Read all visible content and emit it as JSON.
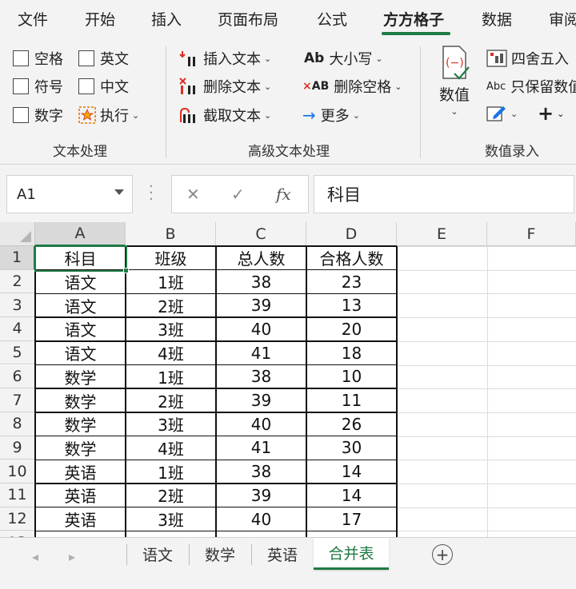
{
  "ribbon_tabs": [
    "文件",
    "开始",
    "插入",
    "页面布局",
    "公式",
    "方方格子",
    "数据",
    "审阅"
  ],
  "active_tab": "方方格子",
  "text_group": {
    "checkboxes": [
      "空格",
      "英文",
      "符号",
      "中文",
      "数字"
    ],
    "execute_label": "执行",
    "label": "文本处理"
  },
  "advanced_group": {
    "insert_text": "插入文本",
    "delete_text": "删除文本",
    "extract_text": "截取文本",
    "case": "大小写",
    "delete_space": "删除空格",
    "more": "更多",
    "label": "高级文本处理",
    "case_icon_text": "Ab",
    "delete_space_icon_text": "AB"
  },
  "number_group": {
    "value_button": "数值",
    "round": "四舍五入",
    "keep_values": "只保留数值",
    "abc_icon_text": "Abc",
    "plus_icon_text": "+",
    "label": "数值录入"
  },
  "formula_bar": {
    "name_box": "A1",
    "formula": "科目",
    "fx_label": "fx"
  },
  "columns": [
    "A",
    "B",
    "C",
    "D",
    "E",
    "F"
  ],
  "rows": [
    [
      "科目",
      "班级",
      "总人数",
      "合格人数"
    ],
    [
      "语文",
      "1班",
      "38",
      "23"
    ],
    [
      "语文",
      "2班",
      "39",
      "13"
    ],
    [
      "语文",
      "3班",
      "40",
      "20"
    ],
    [
      "语文",
      "4班",
      "41",
      "18"
    ],
    [
      "数学",
      "1班",
      "38",
      "10"
    ],
    [
      "数学",
      "2班",
      "39",
      "11"
    ],
    [
      "数学",
      "3班",
      "40",
      "26"
    ],
    [
      "数学",
      "4班",
      "41",
      "30"
    ],
    [
      "英语",
      "1班",
      "38",
      "14"
    ],
    [
      "英语",
      "2班",
      "39",
      "14"
    ],
    [
      "英语",
      "3班",
      "40",
      "17"
    ]
  ],
  "sheet_tabs": [
    "语文",
    "数学",
    "英语",
    "合并表"
  ],
  "active_sheet": "合并表",
  "colors": {
    "accent": "#1f7a44",
    "red_icon": "#d93025",
    "blue_icon": "#1a73e8"
  }
}
